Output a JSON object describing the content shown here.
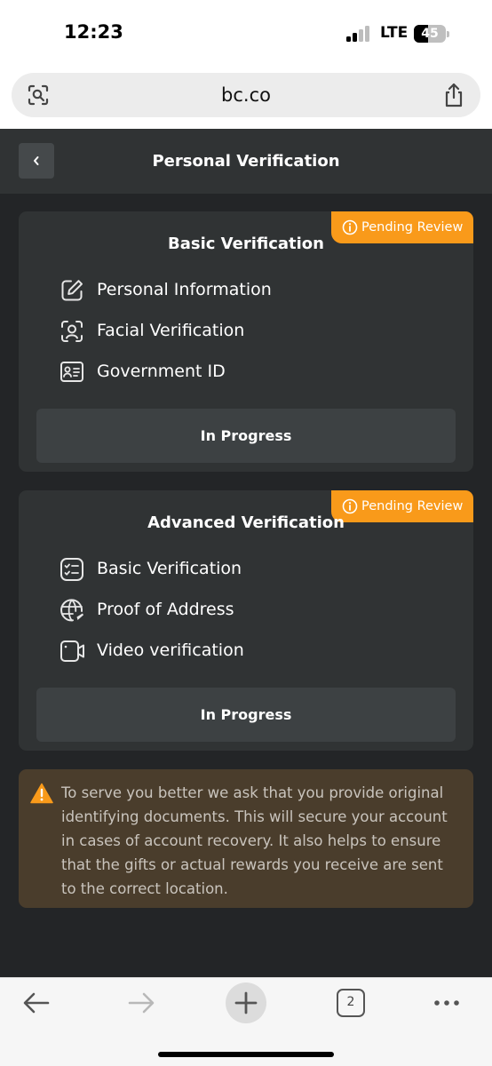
{
  "status_bar": {
    "time": "12:23",
    "network": "LTE",
    "battery": "45",
    "battery_level": 0.45
  },
  "browser": {
    "url": "bc.co",
    "tabs_count": "2"
  },
  "header": {
    "title": "Personal Verification"
  },
  "cards": [
    {
      "title": "Basic Verification",
      "badge": "Pending Review",
      "items": [
        {
          "label": "Personal Information",
          "icon": "edit-icon"
        },
        {
          "label": "Facial Verification",
          "icon": "face-scan-icon"
        },
        {
          "label": "Government ID",
          "icon": "id-card-icon"
        }
      ],
      "status_button": "In Progress"
    },
    {
      "title": "Advanced Verification",
      "badge": "Pending Review",
      "items": [
        {
          "label": "Basic Verification",
          "icon": "checklist-icon"
        },
        {
          "label": "Proof of Address",
          "icon": "globe-icon"
        },
        {
          "label": "Video verification",
          "icon": "video-camera-icon"
        }
      ],
      "status_button": "In Progress"
    }
  ],
  "notice": {
    "text": "To serve you better we ask that you provide original identifying documents. This will secure your account in cases of account recovery. It also helps to ensure that the gifts or actual rewards you receive are sent to the correct location."
  },
  "colors": {
    "accent_orange": "#f99a1a",
    "background": "#232527",
    "card": "#303334",
    "notice_bg": "#4a3d2c"
  }
}
